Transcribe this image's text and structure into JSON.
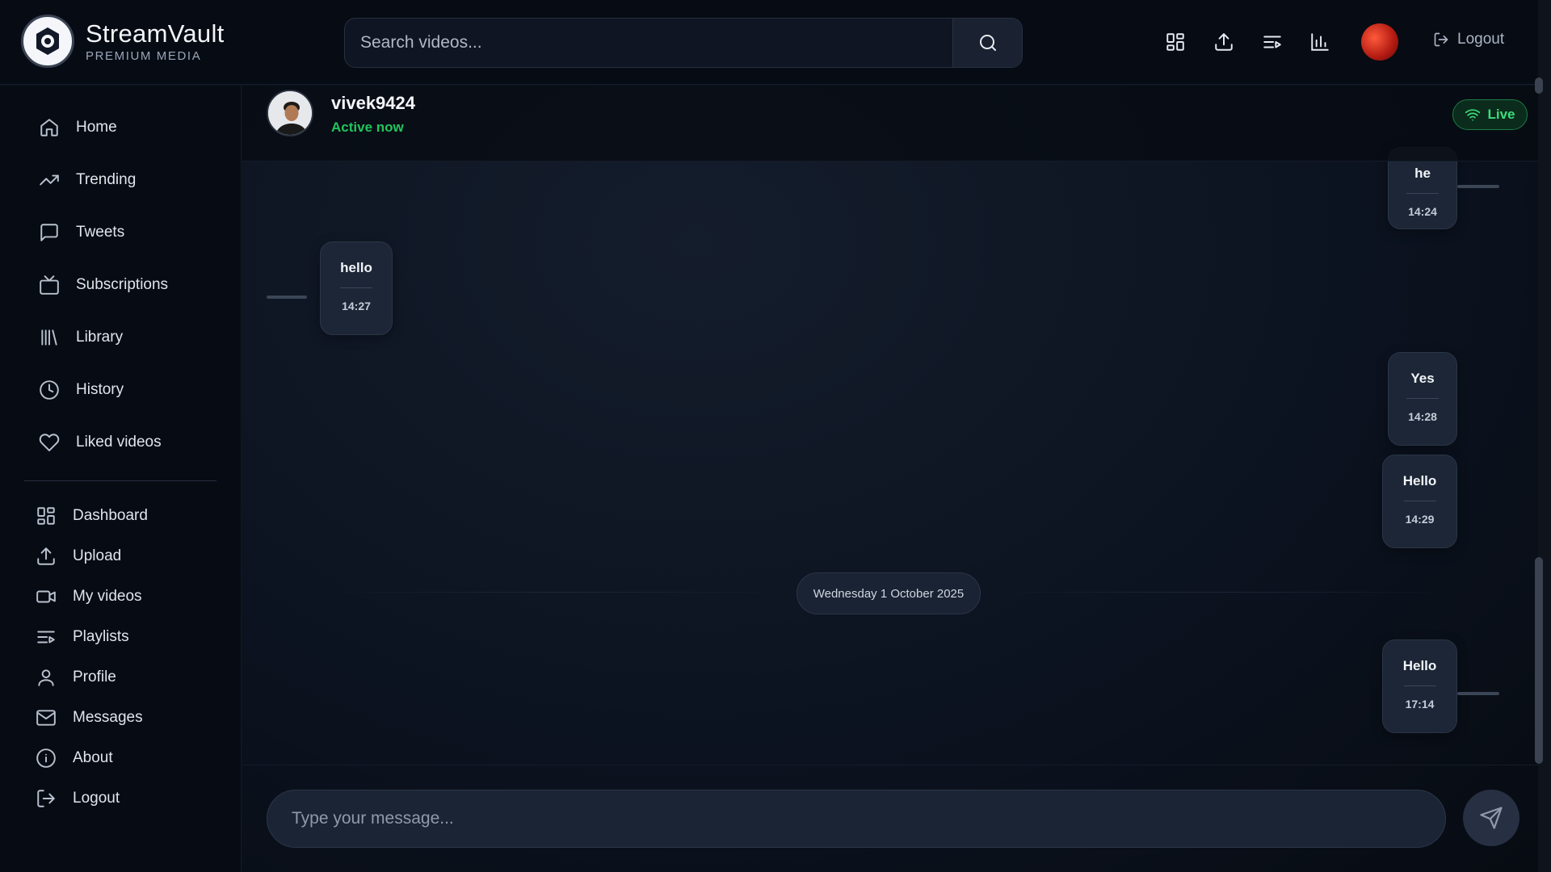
{
  "app": {
    "name": "StreamVault",
    "tagline": "PREMIUM MEDIA"
  },
  "search": {
    "placeholder": "Search videos..."
  },
  "topbar": {
    "logout_label": "Logout"
  },
  "sidebar": {
    "primary": [
      {
        "label": "Home",
        "icon": "home-icon"
      },
      {
        "label": "Trending",
        "icon": "trending-icon"
      },
      {
        "label": "Tweets",
        "icon": "chat-icon"
      },
      {
        "label": "Subscriptions",
        "icon": "tv-icon"
      },
      {
        "label": "Library",
        "icon": "library-icon"
      },
      {
        "label": "History",
        "icon": "clock-icon"
      },
      {
        "label": "Liked videos",
        "icon": "heart-icon"
      }
    ],
    "secondary": [
      {
        "label": "Dashboard",
        "icon": "dashboard-icon"
      },
      {
        "label": "Upload",
        "icon": "upload-icon"
      },
      {
        "label": "My videos",
        "icon": "video-icon"
      },
      {
        "label": "Playlists",
        "icon": "playlist-icon"
      },
      {
        "label": "Profile",
        "icon": "user-icon"
      },
      {
        "label": "Messages",
        "icon": "mail-icon"
      },
      {
        "label": "About",
        "icon": "info-icon"
      },
      {
        "label": "Logout",
        "icon": "logout-icon"
      }
    ]
  },
  "chat": {
    "peer": {
      "username": "vivek9424",
      "status": "Active now"
    },
    "live_label": "Live",
    "messages": [
      {
        "text": "he",
        "time": "14:24",
        "side": "sent"
      },
      {
        "text": "hello",
        "time": "14:27",
        "side": "received"
      },
      {
        "text": "Yes",
        "time": "14:28",
        "side": "sent"
      },
      {
        "text": "Hello",
        "time": "14:29",
        "side": "sent"
      },
      {
        "text": "Hello",
        "time": "17:14",
        "side": "sent"
      }
    ],
    "date_separator": "Wednesday 1 October 2025",
    "composer_placeholder": "Type your message..."
  },
  "colors": {
    "online": "#21c55d",
    "background": "#0b1220",
    "bubble": "#1c2636"
  }
}
